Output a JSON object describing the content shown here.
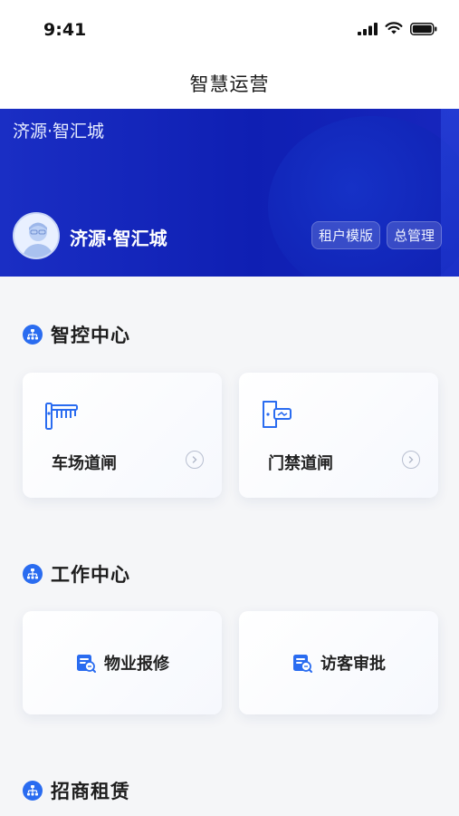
{
  "status_bar": {
    "time": "9:41"
  },
  "nav": {
    "title": "智慧运营"
  },
  "banner": {
    "top_title": "济源·智汇城",
    "user_name": "济源·智汇城",
    "tags": [
      "租户模版",
      "总管理"
    ]
  },
  "sections": {
    "smart_control": {
      "title": "智控中心",
      "cards": [
        {
          "label": "车场道闸",
          "icon": "barrier-gate-icon"
        },
        {
          "label": "门禁道闸",
          "icon": "access-door-icon"
        }
      ]
    },
    "work_center": {
      "title": "工作中心",
      "cards": [
        {
          "label": "物业报修",
          "icon": "repair-icon"
        },
        {
          "label": "访客审批",
          "icon": "visitor-approval-icon"
        }
      ]
    },
    "leasing": {
      "title": "招商租赁"
    }
  },
  "colors": {
    "banner_blue": "#1325bd",
    "accent_blue": "#2a6cf0",
    "background": "#f5f6f8"
  }
}
